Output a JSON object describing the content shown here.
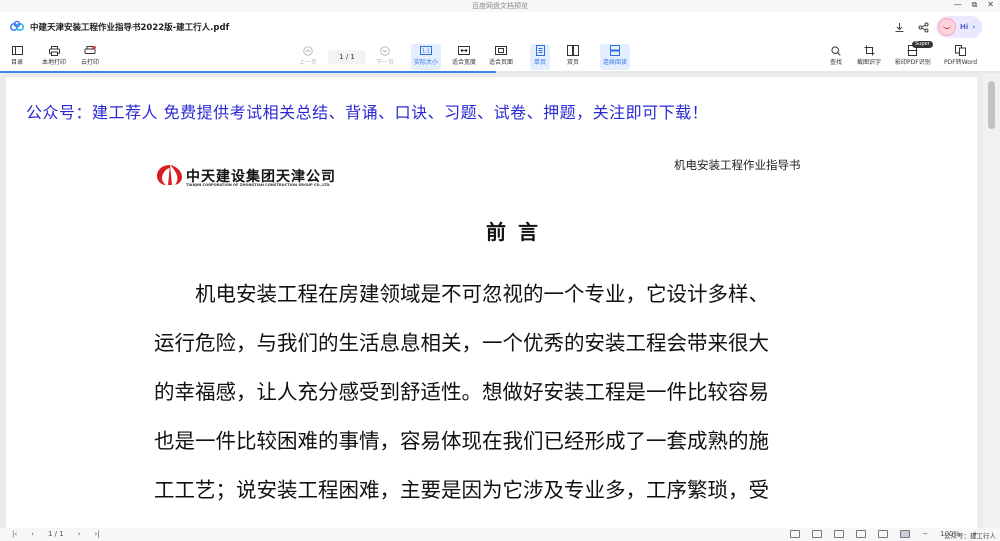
{
  "window": {
    "app_title": "百度网盘文档预览",
    "controls": [
      "—",
      "⧉",
      "✕"
    ]
  },
  "document": {
    "title": "中建天津安装工程作业指导书2022版-建工行人.pdf"
  },
  "account": {
    "greeting": "Hi",
    "chevron": "›"
  },
  "toolbar": {
    "toc": "目录",
    "local_print": "本地打印",
    "cloud_print": "云打印",
    "prev_page": "上一页",
    "page_indicator": "1 / 1",
    "next_page": "下一页",
    "actual_size": "实际大小",
    "fit_width": "适合宽度",
    "fit_page": "适合页面",
    "single_page": "单页",
    "double_page": "双页",
    "continuous": "连续阅读",
    "search": "查找",
    "screenshot_ocr": "截图识字",
    "scan_ocr": "影印PDF识别",
    "scan_badge": "Super",
    "pdf_to_word": "PDF转Word"
  },
  "content": {
    "banner": "公众号：建工荐人 免费提供考试相关总结、背诵、口诀、习题、试卷、押题，关注即可下载！",
    "company_name": "中天建设集团天津公司",
    "company_sub": "TIANJIN CORPORATION OF ZHONGTIAN CONSTRUCTION GROUP CO.,LTD.",
    "doc_header": "机电安装工程作业指导书",
    "section_title": "前言",
    "paragraph_lines": [
      "　　机电安装工程在房建领域是不可忽视的一个专业，它设计多样、",
      "运行危险，与我们的生活息息相关，一个优秀的安装工程会带来很大",
      "的幸福感，让人充分感受到舒适性。想做好安装工程是一件比较容易",
      "也是一件比较困难的事情，容易体现在我们已经形成了一套成熟的施",
      "工工艺；说安装工程困难，主要是因为它涉及专业多，工序繁琐，受"
    ]
  },
  "statusbar": {
    "page_indicator": "1 / 1",
    "zoom": "100%",
    "watermark": "公众号：建工行人"
  },
  "progress": {
    "fraction": 0.496
  },
  "colors": {
    "accent": "#3a86f0",
    "banner_text": "#2a2ad2",
    "logo_red": "#d81e1e"
  }
}
